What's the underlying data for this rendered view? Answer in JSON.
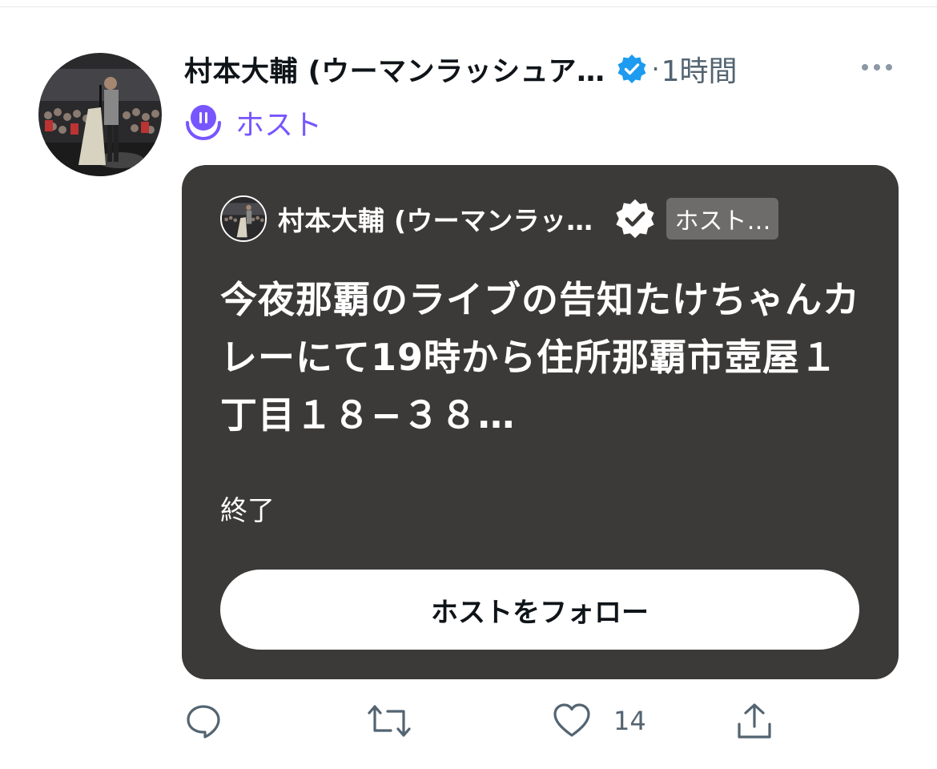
{
  "tweet": {
    "display_name": "村本大輔 (ウーマンラッシュア…",
    "time_separator": "·",
    "time": "1時間",
    "host_role_label": "ホスト"
  },
  "space_card": {
    "host_name": "村本大輔 (ウーマンラッ…",
    "host_tag": "ホスト…",
    "title": "今夜那覇のライブの告知たけちゃんカレーにて19時から住所那覇市壺屋１丁目１８−３８…",
    "status": "終了",
    "follow_button_label": "ホストをフォロー"
  },
  "actions": {
    "like_count": "14"
  },
  "icons": {
    "verified": "verified-badge-icon",
    "more": "more-dots-icon",
    "spaces": "spaces-mic-icon",
    "reply": "reply-icon",
    "retweet": "retweet-icon",
    "like": "heart-icon",
    "share": "share-icon"
  },
  "colors": {
    "verified_blue": "#1d9bf0",
    "host_purple": "#7856ff",
    "card_bg": "#3c3a38",
    "secondary_text": "#536471"
  }
}
